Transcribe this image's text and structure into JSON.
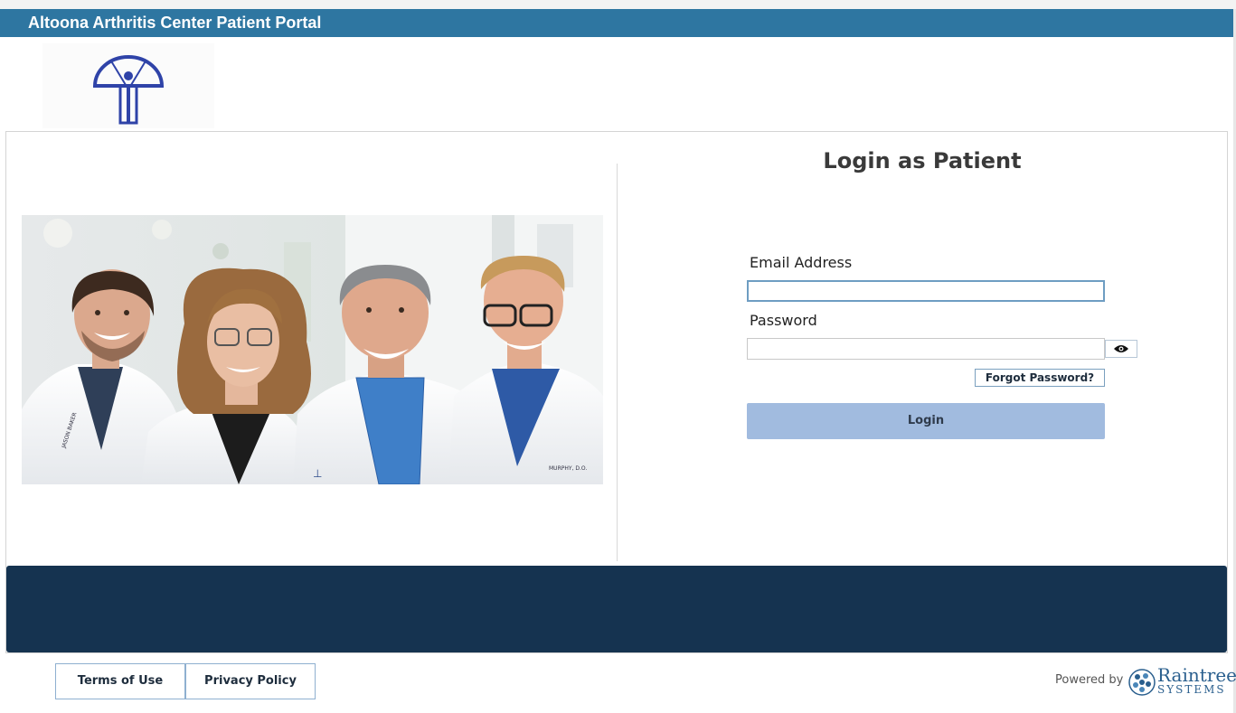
{
  "header": {
    "title": "Altoona Arthritis Center Patient Portal"
  },
  "logo": {
    "name": "altoona-arthritis-logo",
    "color": "#2f43a8"
  },
  "login": {
    "title": "Login as Patient",
    "email_label": "Email Address",
    "email_value": "",
    "password_label": "Password",
    "password_value": "",
    "forgot_label": "Forgot Password?",
    "login_label": "Login",
    "login_color": "#a1bbdf"
  },
  "photo": {
    "name_tag_1": "JASON BAKER D.O. RHEUMATOLOGY",
    "name_tag_2": "FREDERICK MURPHY, D.O. RHEUMATOLOGY"
  },
  "footer": {
    "terms_label": "Terms of Use",
    "privacy_label": "Privacy Policy",
    "powered_label": "Powered by",
    "brand_line1": "Raintree",
    "brand_line2": "SYSTEMS",
    "band_color": "#153350"
  },
  "colors": {
    "header": "#2e76a1",
    "accent": "#6e9dc2"
  }
}
